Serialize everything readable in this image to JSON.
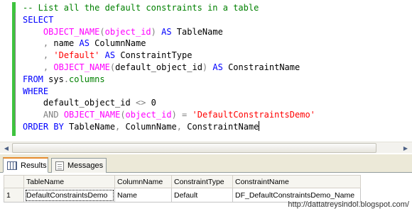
{
  "editor": {
    "lines": [
      [
        {
          "t": "-- List all the default constraints in a table",
          "c": "cm"
        }
      ],
      [
        {
          "t": "SELECT",
          "c": "kw"
        }
      ],
      [
        {
          "t": "    ",
          "c": ""
        },
        {
          "t": "OBJECT_NAME",
          "c": "fn"
        },
        {
          "t": "(",
          "c": "gr"
        },
        {
          "t": "object_id",
          "c": "fn"
        },
        {
          "t": ")",
          "c": "gr"
        },
        {
          "t": " ",
          "c": ""
        },
        {
          "t": "AS",
          "c": "kw"
        },
        {
          "t": " TableName",
          "c": ""
        }
      ],
      [
        {
          "t": "    ",
          "c": ""
        },
        {
          "t": ",",
          "c": "gr"
        },
        {
          "t": " name ",
          "c": ""
        },
        {
          "t": "AS",
          "c": "kw"
        },
        {
          "t": " ColumnName",
          "c": ""
        }
      ],
      [
        {
          "t": "    ",
          "c": ""
        },
        {
          "t": ",",
          "c": "gr"
        },
        {
          "t": " ",
          "c": ""
        },
        {
          "t": "'Default'",
          "c": "str"
        },
        {
          "t": " ",
          "c": ""
        },
        {
          "t": "AS",
          "c": "kw"
        },
        {
          "t": " ConstraintType",
          "c": ""
        }
      ],
      [
        {
          "t": "    ",
          "c": ""
        },
        {
          "t": ",",
          "c": "gr"
        },
        {
          "t": " ",
          "c": ""
        },
        {
          "t": "OBJECT_NAME",
          "c": "fn"
        },
        {
          "t": "(",
          "c": "gr"
        },
        {
          "t": "default_object_id",
          "c": ""
        },
        {
          "t": ")",
          "c": "gr"
        },
        {
          "t": " ",
          "c": ""
        },
        {
          "t": "AS",
          "c": "kw"
        },
        {
          "t": " ConstraintName",
          "c": ""
        }
      ],
      [
        {
          "t": "FROM",
          "c": "kw"
        },
        {
          "t": " sys",
          "c": ""
        },
        {
          "t": ".",
          "c": "gr"
        },
        {
          "t": "columns",
          "c": "cm"
        }
      ],
      [
        {
          "t": "WHERE",
          "c": "kw"
        }
      ],
      [
        {
          "t": "    default_object_id ",
          "c": ""
        },
        {
          "t": "<>",
          "c": "gr"
        },
        {
          "t": " 0",
          "c": ""
        }
      ],
      [
        {
          "t": "    ",
          "c": ""
        },
        {
          "t": "AND",
          "c": "gr"
        },
        {
          "t": " ",
          "c": ""
        },
        {
          "t": "OBJECT_NAME",
          "c": "fn"
        },
        {
          "t": "(",
          "c": "gr"
        },
        {
          "t": "object_id",
          "c": "fn"
        },
        {
          "t": ")",
          "c": "gr"
        },
        {
          "t": " ",
          "c": ""
        },
        {
          "t": "=",
          "c": "gr"
        },
        {
          "t": " ",
          "c": ""
        },
        {
          "t": "'DefaultConstraintsDemo'",
          "c": "str"
        }
      ],
      [
        {
          "t": "ORDER BY",
          "c": "kw"
        },
        {
          "t": " TableName",
          "c": ""
        },
        {
          "t": ",",
          "c": "gr"
        },
        {
          "t": " ColumnName",
          "c": ""
        },
        {
          "t": ",",
          "c": "gr"
        },
        {
          "t": " ConstraintName",
          "c": ""
        }
      ]
    ]
  },
  "tabs": {
    "results_label": "Results",
    "messages_label": "Messages"
  },
  "grid": {
    "columns": [
      "TableName",
      "ColumnName",
      "ConstraintType",
      "ConstraintName"
    ],
    "rows": [
      {
        "num": "1",
        "cells": [
          "DefaultConstraintsDemo",
          "Name",
          "Default",
          "DF_DefaultConstraintsDemo_Name"
        ]
      }
    ]
  },
  "watermark": "http://dattatreysindol.blogspot.com/",
  "colors": {
    "keyword": "#0000ff",
    "function": "#ff00ff",
    "string": "#ff0000",
    "comment": "#008000",
    "operator": "#808080",
    "change_bar": "#3fc33f"
  }
}
